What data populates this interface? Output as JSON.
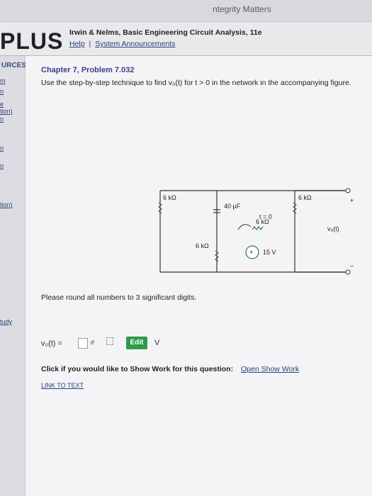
{
  "topbar": {
    "text": "ntegrity Matters"
  },
  "brand": {
    "logo": "PLUS"
  },
  "header": {
    "book_title": "Irwin & Nelms, Basic Engineering Circuit Analysis, 11e",
    "help": "Help",
    "separator": "|",
    "announcements": "System Announcements"
  },
  "sidebar": {
    "heading": "URCES",
    "items": [
      "m",
      "n",
      "e",
      "tion)",
      "n",
      "n",
      "n",
      "tion)",
      "tudy"
    ]
  },
  "problem": {
    "title": "Chapter 7, Problem 7.032",
    "text": "Use the step-by-step technique to find v₀(t) for t > 0 in the network in the accompanying figure."
  },
  "circuit": {
    "r1": "6 kΩ",
    "c1": "40 µF",
    "r2": "6 kΩ",
    "r3": "6 kΩ",
    "r4": "6 kΩ",
    "switch": "t = 0",
    "source": "15 V",
    "out_label": "v₀(t)",
    "plus": "+",
    "minus": "–"
  },
  "note": "Please round all numbers to 3 significant digits.",
  "answer": {
    "label": "v₀(t) =",
    "exp": "e",
    "edit": "Edit",
    "unit": "V"
  },
  "showwork": {
    "question": "Click if you would like to Show Work for this question:",
    "link": "Open Show Work"
  },
  "link_to_text": "LINK TO TEXT"
}
